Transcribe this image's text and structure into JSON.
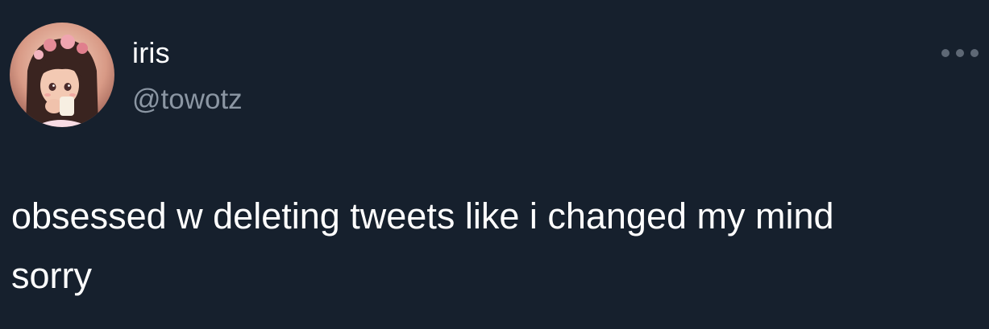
{
  "tweet": {
    "author": {
      "display_name": "iris",
      "handle": "@towotz",
      "avatar_icon": "profile-avatar"
    },
    "more_icon": "more-horizontal-icon",
    "text": "obsessed w deleting tweets like i changed my mind\nsorry"
  },
  "colors": {
    "background": "#16202d",
    "text": "#ffffff",
    "secondary_text": "#8b96a3",
    "icon": "#5e6875"
  }
}
